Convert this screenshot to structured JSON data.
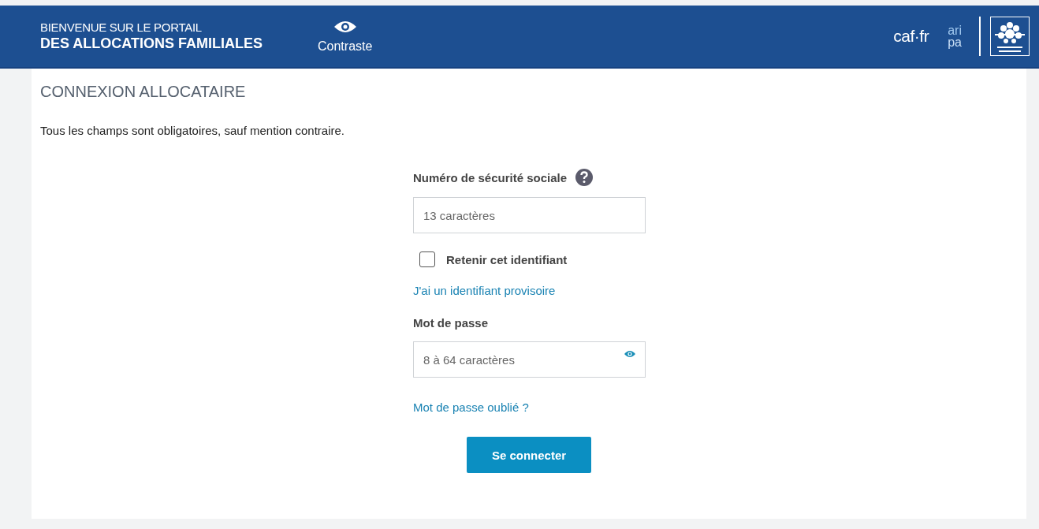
{
  "header": {
    "title_line1": "BIENVENUE SUR LE PORTAIL",
    "title_line2": "DES ALLOCATIONS FAMILIALES",
    "contrast_button": "Contraste",
    "logos": {
      "caf": "caf·fr",
      "aripa_line1": "ari",
      "aripa_line2": "pa"
    }
  },
  "page_title": "CONNEXION ALLOCATAIRE",
  "notice": "Tous les champs sont obligatoires, sauf mention contraire.",
  "form": {
    "ssn_label": "Numéro de sécurité sociale",
    "ssn_placeholder": "13 caractères",
    "remember": {
      "label": "Retenir cet identifiant",
      "checked": false
    },
    "temp_id_link": "J'ai un identifiant provisoire",
    "password_label": "Mot de passe",
    "password_placeholder": "8 à 64 caractères",
    "forgot_link": "Mot de passe oublié ?",
    "submit": "Se connecter"
  }
}
